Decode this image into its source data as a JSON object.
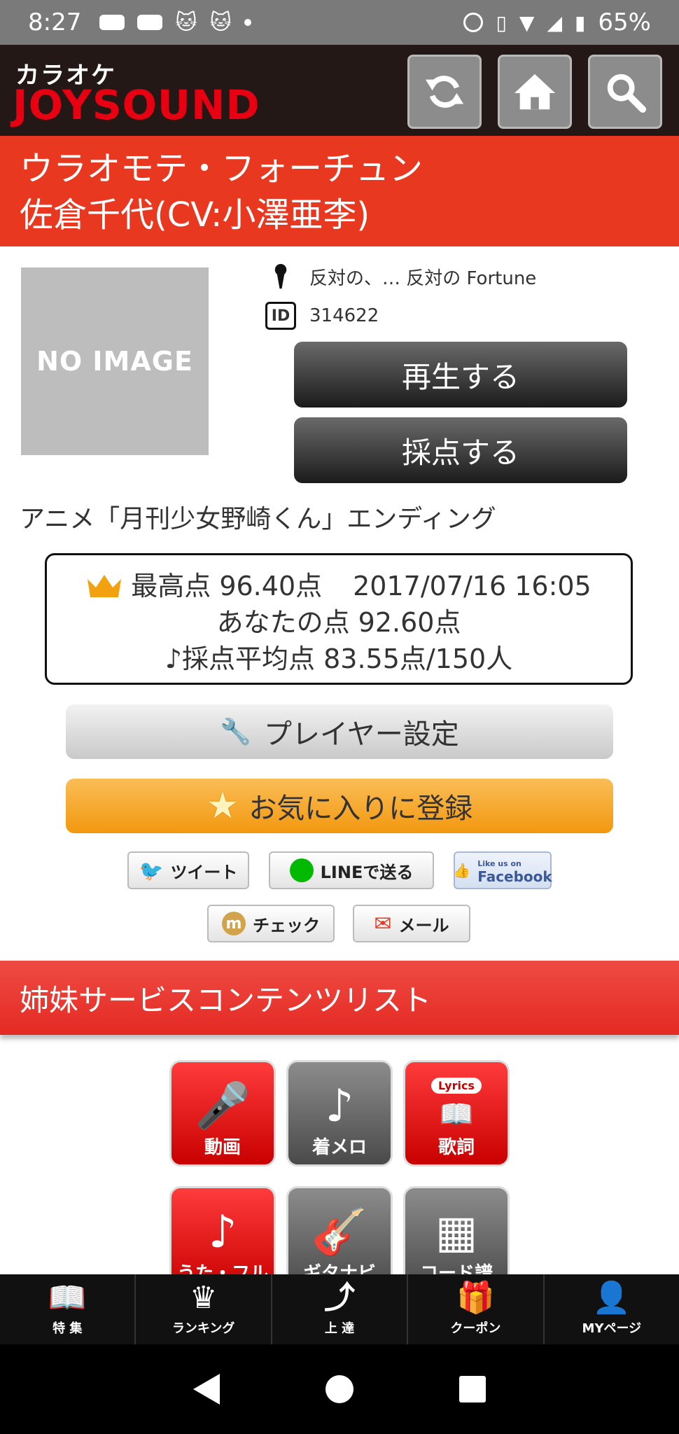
{
  "status_bar": {
    "time": "8:27",
    "battery": "65%"
  },
  "header": {
    "logo_top": "カラオケ",
    "logo_main": "JOYSOUND"
  },
  "song": {
    "title": "ウラオモテ・フォーチュン",
    "artist": "佐倉千代(CV:小澤亜李)",
    "no_image_label": "NO IMAGE",
    "lyric_start": "反対の、… 反対の Fortune",
    "id": "314622",
    "tieup": "アニメ「月刊少女野崎くん」エンディング"
  },
  "buttons": {
    "play": "再生する",
    "score": "採点する",
    "player_settings": "プレイヤー設定",
    "favorite": "お気に入りに登録"
  },
  "score": {
    "best": "最高点 96.40点",
    "best_date": "2017/07/16 16:05",
    "yours": "あなたの点 92.60点",
    "average": "♪採点平均点 83.55点/150人"
  },
  "share": {
    "tweet": "ツイート",
    "line": "LINEで送る",
    "facebook_small": "Like us on",
    "facebook": "Facebook",
    "check": "チェック",
    "mail": "メール"
  },
  "sister": {
    "heading": "姉妹サービスコンテンツリスト",
    "tiles": [
      {
        "label": "動画",
        "color": "red"
      },
      {
        "label": "着メロ",
        "color": "gray"
      },
      {
        "label": "歌詞",
        "badge": "Lyrics",
        "color": "red"
      },
      {
        "label": "うた・フル",
        "color": "red"
      },
      {
        "label": "ギタナビ",
        "color": "gray"
      },
      {
        "label": "コード譜",
        "color": "gray"
      }
    ]
  },
  "tabs": [
    {
      "label": "特 集",
      "icon": "book-icon"
    },
    {
      "label": "ランキング",
      "icon": "crown-icon"
    },
    {
      "label": "上 達",
      "icon": "arrow-up-icon"
    },
    {
      "label": "クーポン",
      "icon": "gift-icon"
    },
    {
      "label": "MYページ",
      "icon": "person-icon"
    }
  ],
  "colors": {
    "brand_red": "#e8381f",
    "header_dark": "#231815",
    "favorite_orange": "#f2980f"
  }
}
